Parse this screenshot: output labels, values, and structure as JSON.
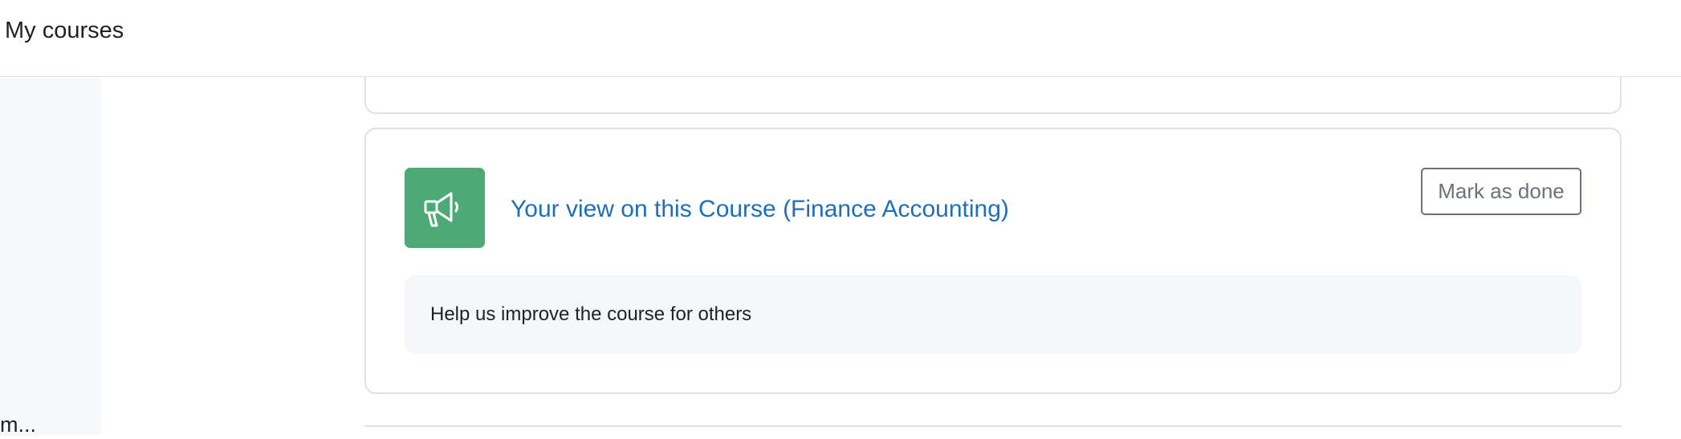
{
  "header": {
    "nav_label": "My courses"
  },
  "sidebar": {
    "truncated_item": "m..."
  },
  "activity": {
    "icon": "megaphone-icon",
    "title": "Your view on this Course (Finance Accounting)",
    "mark_done_label": "Mark as done",
    "description": "Help us improve the course for others"
  },
  "colors": {
    "accent": "#1f6fb8",
    "activity_icon_bg": "#4daa76"
  }
}
